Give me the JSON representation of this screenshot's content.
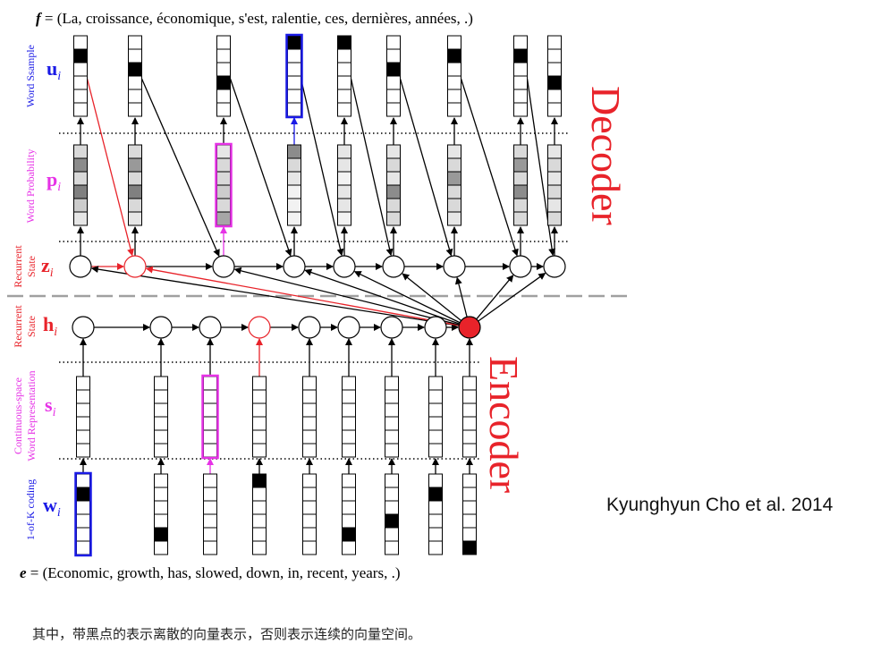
{
  "target_sentence": {
    "prefix": "f",
    "rest": " = (La, croissance, économique, s'est, ralentie, ces, dernières, années, .)"
  },
  "source_sentence": {
    "prefix": "e",
    "rest": " = (Economic, growth, has, slowed, down, in, recent, years, .)"
  },
  "sections": {
    "decoder": "Decoder",
    "encoder": "Encoder"
  },
  "row_labels": {
    "word_sample": "Word Ssample",
    "word_probability": "Word Probability",
    "recurrent": "Recurrent",
    "state": "State",
    "continuous_space": "Continuous-space",
    "word_representation": "Word Representation",
    "one_of_k": "1-of-K coding"
  },
  "symbols": {
    "u": {
      "main": "u",
      "sub": "i"
    },
    "p": {
      "main": "p",
      "sub": "i"
    },
    "z": {
      "main": "z",
      "sub": "i"
    },
    "h": {
      "main": "h",
      "sub": "i"
    },
    "s": {
      "main": "s",
      "sub": "i"
    },
    "w": {
      "main": "w",
      "sub": "i"
    }
  },
  "colors": {
    "blue": "#1a1ae6",
    "magenta": "#e632e6",
    "red": "#e8232a",
    "black": "#000000",
    "dashed_divider": "#a0a0a0"
  },
  "decoder": {
    "columns": 9,
    "highlight_column": 1,
    "word_sample": {
      "black_cell_index": [
        1,
        2,
        3,
        0,
        0,
        2,
        1,
        1,
        3
      ],
      "highlight_column": 3
    },
    "word_probability_shades": [
      [
        0.85,
        0.55,
        0.85,
        0.5,
        0.8,
        0.9
      ],
      [
        0.85,
        0.6,
        0.85,
        0.5,
        0.85,
        0.9
      ],
      [
        0.9,
        0.85,
        0.85,
        0.8,
        0.85,
        0.65
      ],
      [
        0.55,
        0.85,
        0.9,
        0.95,
        0.95,
        0.95
      ],
      [
        0.9,
        0.9,
        0.95,
        0.9,
        0.9,
        0.95
      ],
      [
        0.9,
        0.85,
        0.9,
        0.55,
        0.85,
        0.85
      ],
      [
        0.9,
        0.85,
        0.6,
        0.85,
        0.85,
        0.9
      ],
      [
        0.85,
        0.6,
        0.85,
        0.55,
        0.85,
        0.85
      ],
      [
        0.9,
        0.85,
        0.9,
        0.85,
        0.9,
        0.85
      ]
    ],
    "word_probability_highlight_column": 2
  },
  "encoder": {
    "columns": 9,
    "one_hot_black_cell_index": [
      1,
      4,
      6,
      0,
      -1,
      4,
      3,
      1,
      5
    ],
    "one_hot_highlight_column": 0,
    "representation_highlight_column": 2,
    "state_highlight_column": 3,
    "summary_node_filled": true
  },
  "citation": "Kyunghyun Cho et al. 2014",
  "caption": "其中，带黑点的表示离散的向量表示，否则表示连续的向量空间。"
}
